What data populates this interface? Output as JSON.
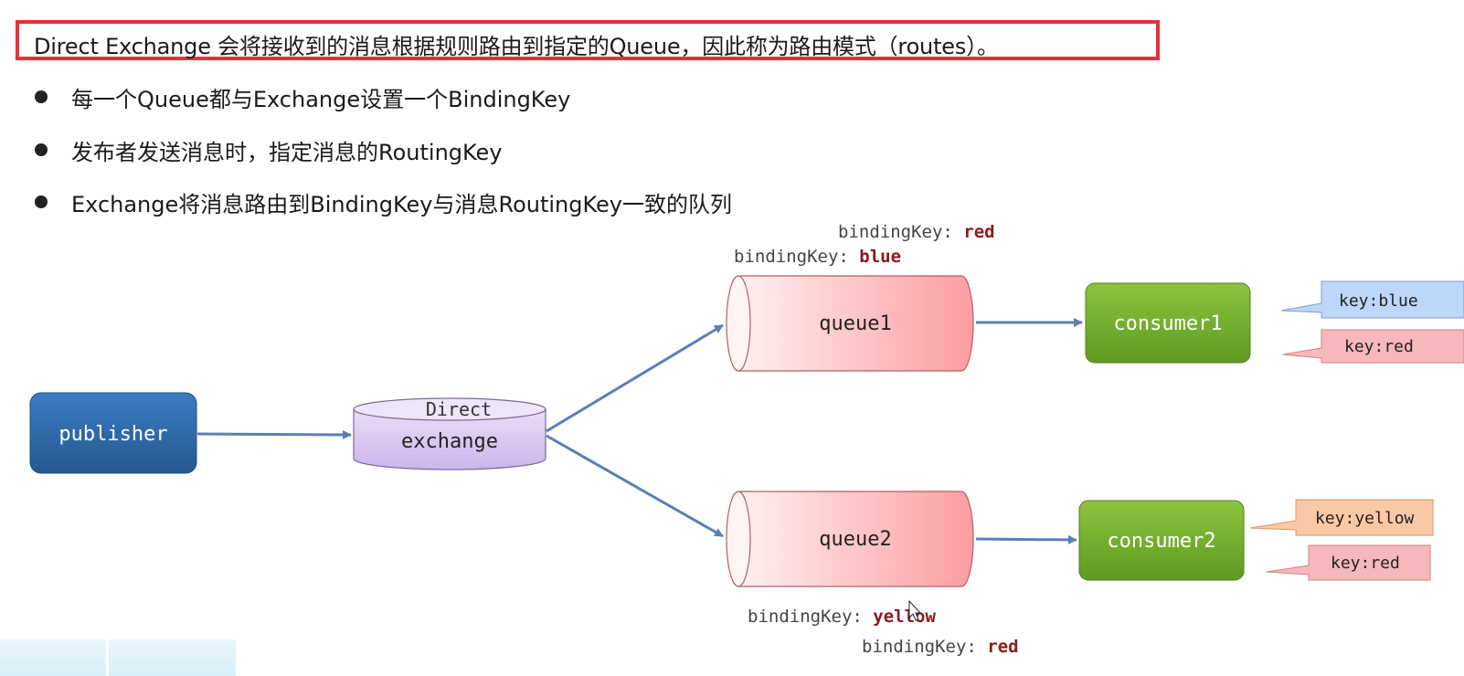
{
  "title": "Direct Exchange 会将接收到的消息根据规则路由到指定的Queue，因此称为路由模式（routes）。",
  "bullets": [
    "每一个Queue都与Exchange设置一个BindingKey",
    "发布者发送消息时，指定消息的RoutingKey",
    "Exchange将消息路由到BindingKey与消息RoutingKey一致的队列"
  ],
  "diagram": {
    "publisher": "publisher",
    "exchange": {
      "type_label": "Direct",
      "label": "exchange"
    },
    "queues": [
      {
        "label": "queue1",
        "binding_keys": [
          {
            "prefix": "bindingKey: ",
            "value": "red"
          },
          {
            "prefix": "bindingKey: ",
            "value": "blue"
          }
        ]
      },
      {
        "label": "queue2",
        "binding_keys": [
          {
            "prefix": "bindingKey: ",
            "value": "yellow"
          },
          {
            "prefix": "bindingKey: ",
            "value": "red"
          }
        ]
      }
    ],
    "consumers": [
      {
        "label": "consumer1",
        "keys": [
          {
            "text": "key:blue",
            "color": "#bcd7f7"
          },
          {
            "text": "key:red",
            "color": "#f7b8bb"
          }
        ]
      },
      {
        "label": "consumer2",
        "keys": [
          {
            "text": "key:yellow",
            "color": "#fbc8a6"
          },
          {
            "text": "key:red",
            "color": "#f7b8bb"
          }
        ]
      }
    ]
  },
  "colors": {
    "title_border": "#e8303a",
    "publisher": "#2f6aac",
    "exchange": "#d9c6ef",
    "queue": "#fda3a6",
    "consumer": "#76ab30",
    "arrow": "#5a80b5",
    "binding_value": "#8b1a1a"
  }
}
